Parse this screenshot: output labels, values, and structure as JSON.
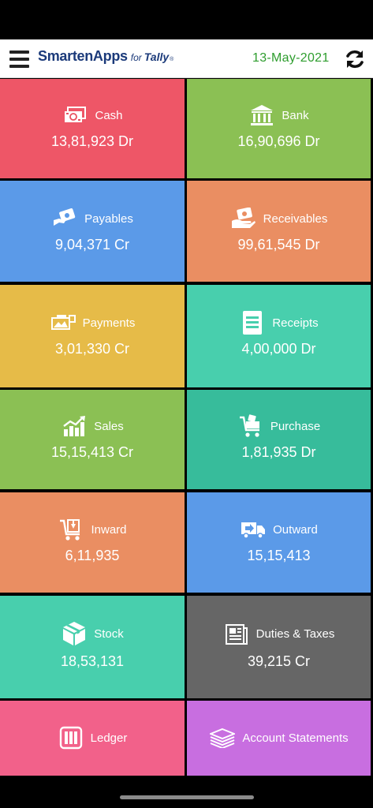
{
  "header": {
    "logo_main": "SmartenApps",
    "logo_for": "for",
    "logo_tally": "Tally",
    "logo_reg": "®",
    "date": "13-May-2021"
  },
  "tiles": [
    {
      "label": "Cash",
      "value": "13,81,923 Dr",
      "color": "#ee5667",
      "icon": "cash-icon"
    },
    {
      "label": "Bank",
      "value": "16,90,696 Dr",
      "color": "#8bc054",
      "icon": "bank-icon"
    },
    {
      "label": "Payables",
      "value": "9,04,371 Cr",
      "color": "#5b9ae8",
      "icon": "payables-icon"
    },
    {
      "label": "Receivables",
      "value": "99,61,545 Dr",
      "color": "#ea8e62",
      "icon": "receivables-icon"
    },
    {
      "label": "Payments",
      "value": "3,01,330 Cr",
      "color": "#e6bb48",
      "icon": "payments-icon"
    },
    {
      "label": "Receipts",
      "value": "4,00,000 Dr",
      "color": "#48cfad",
      "icon": "receipts-icon"
    },
    {
      "label": "Sales",
      "value": "15,15,413 Cr",
      "color": "#8bc054",
      "icon": "sales-icon"
    },
    {
      "label": "Purchase",
      "value": "1,81,935 Dr",
      "color": "#37bc9b",
      "icon": "purchase-icon"
    },
    {
      "label": "Inward",
      "value": "6,11,935",
      "color": "#ea8e62",
      "icon": "inward-icon"
    },
    {
      "label": "Outward",
      "value": "15,15,413",
      "color": "#5b9ae8",
      "icon": "outward-icon"
    },
    {
      "label": "Stock",
      "value": "18,53,131",
      "color": "#48cfad",
      "icon": "stock-icon"
    },
    {
      "label": "Duties & Taxes",
      "value": "39,215 Cr",
      "color": "#666666",
      "icon": "duties-taxes-icon"
    },
    {
      "label": "Ledger",
      "value": "",
      "color": "#f2618a",
      "icon": "ledger-icon"
    },
    {
      "label": "Account Statements",
      "value": "",
      "color": "#c86ee0",
      "icon": "account-statements-icon"
    }
  ]
}
